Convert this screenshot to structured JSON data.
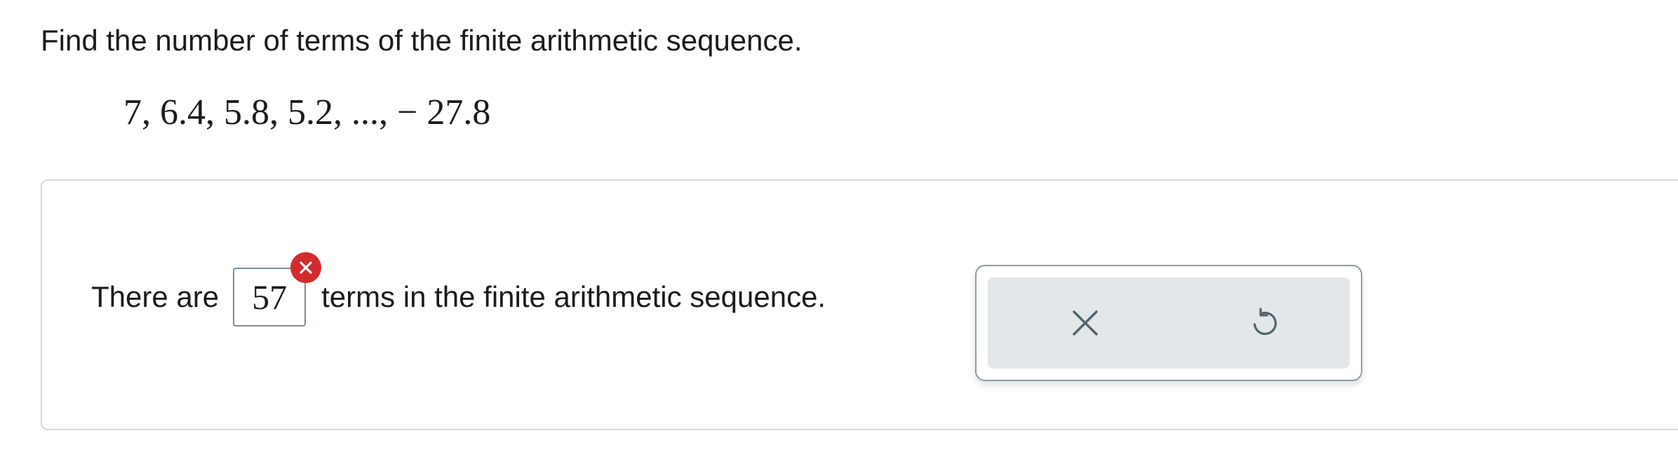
{
  "question": {
    "prompt": "Find the number of terms of the finite arithmetic sequence.",
    "sequence": "7, 6.4, 5.8, 5.2, ..., − 27.8"
  },
  "answer": {
    "prefix": "There are",
    "value": "57",
    "suffix": "terms in the finite arithmetic sequence.",
    "status": "incorrect"
  },
  "actions": {
    "clear_icon": "x-icon",
    "undo_icon": "undo-icon"
  },
  "colors": {
    "error": "#d22b2b",
    "border": "#8c9da4",
    "action_bg": "#e3e7e9"
  }
}
